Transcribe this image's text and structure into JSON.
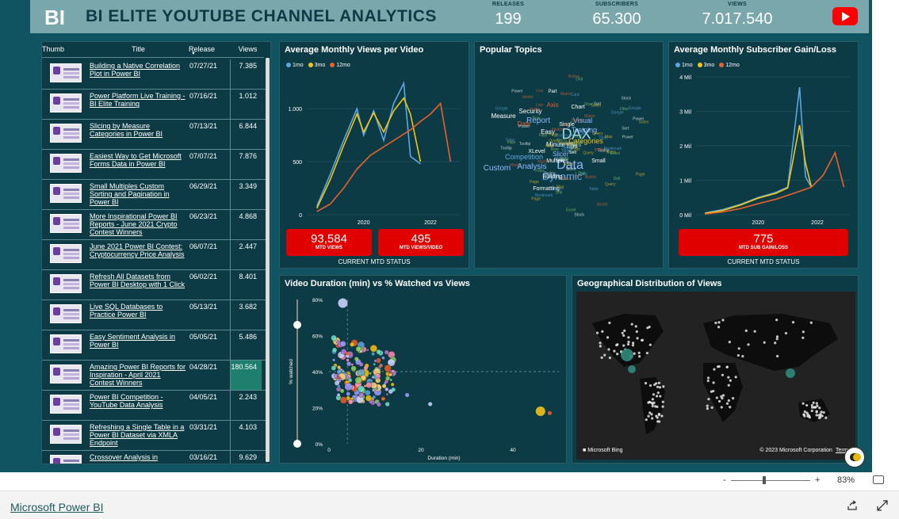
{
  "header": {
    "title": "BI ELITE YOUTUBE CHANNEL ANALYTICS",
    "logo_text": "BI",
    "kpis": [
      {
        "label": "RELEASES",
        "value": "199"
      },
      {
        "label": "SUBSCRIBERS",
        "value": "65.300"
      },
      {
        "label": "VIEWS",
        "value": "7.017.540"
      }
    ]
  },
  "table": {
    "headers": [
      "Thumb",
      "Title",
      "Release",
      "Views"
    ],
    "sort_icon": "sort-down-icon",
    "rows": [
      {
        "title": "Building a Native Correlation Plot in Power BI",
        "release": "07/27/21",
        "views": "7.385"
      },
      {
        "title": "Power Platform Live Training - BI Elite Training",
        "release": "07/16/21",
        "views": "1.012"
      },
      {
        "title": "Slicing by Measure Categories in Power BI",
        "release": "07/13/21",
        "views": "6.844"
      },
      {
        "title": "Easiest Way to Get Microsoft Forms Data in Power BI",
        "release": "07/07/21",
        "views": "7.876"
      },
      {
        "title": "Small Multiples Custom Sorting and Pagination in Power BI",
        "release": "06/29/21",
        "views": "3.349"
      },
      {
        "title": "More Inspirational Power BI Reports - June 2021 Crypto Contest Winners",
        "release": "06/23/21",
        "views": "4.868"
      },
      {
        "title": "June 2021 Power BI Contest: Cryptocurrency Price Analysis",
        "release": "06/07/21",
        "views": "2.447"
      },
      {
        "title": "Refresh All Datasets from Power BI Desktop with 1 Click",
        "release": "06/02/21",
        "views": "8.401"
      },
      {
        "title": "Live SQL Databases to Practice Power BI",
        "release": "05/13/21",
        "views": "3.682"
      },
      {
        "title": "Easy Sentiment Analysis in Power BI",
        "release": "05/05/21",
        "views": "5.486"
      },
      {
        "title": "Amazing Power BI Reports for Inspiration - April 2021 Contest Winners",
        "release": "04/28/21",
        "views": "180.564"
      },
      {
        "title": "Power BI Competition - YouTube Data Analysis",
        "release": "04/05/21",
        "views": "2.243"
      },
      {
        "title": "Refreshing a Single Table in a Power BI Dataset via XMLA Endpoint",
        "release": "03/31/21",
        "views": "4.103"
      },
      {
        "title": "Crossover Analysis in",
        "release": "03/16/21",
        "views": "9.629"
      }
    ]
  },
  "avg_views": {
    "title": "Average Monthly Views per Video",
    "legend": [
      "1mo",
      "3mo",
      "12mo"
    ],
    "kpis": [
      {
        "value": "93,584",
        "label": "MTD VIEWS"
      },
      {
        "value": "495",
        "label": "MTD VIEWS/VIDEO"
      }
    ],
    "status": "CURRENT MTD STATUS"
  },
  "topics": {
    "title": "Popular Topics"
  },
  "subs": {
    "title": "Average Monthly Subscriber Gain/Loss",
    "legend": [
      "1mo",
      "3mo",
      "12mo"
    ],
    "kpis": [
      {
        "value": "775",
        "label": "MTD SUB GAIN/LOSS"
      }
    ],
    "status": "CURRENT MTD STATUS"
  },
  "duration": {
    "title": "Video Duration (min) vs % Watched vs Views"
  },
  "geo": {
    "title": "Geographical Distribution of Views",
    "bing": "Microsoft Bing",
    "copyright": "© 2023 Microsoft Corporation",
    "terms": "Terms"
  },
  "zoom": {
    "minus": "-",
    "plus": "+",
    "level": "83%"
  },
  "footer": {
    "link": "Microsoft Power BI"
  },
  "colors": {
    "accent": "#115461",
    "kpi_red": "#e00000",
    "s1mo": "#5ba8e0",
    "s3mo": "#f2c417",
    "s12mo": "#e8612c"
  },
  "chart_data": [
    {
      "type": "line",
      "title": "Average Monthly Views per Video",
      "ylim": [
        0,
        1300
      ],
      "x_ticks": [
        "2020",
        "2022"
      ],
      "y_ticks": [
        "0",
        "500",
        "1.000"
      ],
      "series": [
        {
          "name": "1mo",
          "x": [
            2018.6,
            2019.0,
            2019.4,
            2019.8,
            2020.0,
            2020.3,
            2020.6,
            2020.9,
            2021.2,
            2021.4,
            2021.7
          ],
          "values": [
            80,
            380,
            700,
            1000,
            750,
            980,
            700,
            1050,
            1240,
            550,
            480
          ]
        },
        {
          "name": "3mo",
          "x": [
            2018.6,
            2019.0,
            2019.4,
            2019.8,
            2020.0,
            2020.3,
            2020.6,
            2020.9,
            2021.2,
            2021.4,
            2021.7
          ],
          "values": [
            60,
            330,
            650,
            950,
            780,
            960,
            780,
            980,
            1100,
            950,
            500
          ]
        },
        {
          "name": "12mo",
          "x": [
            2018.6,
            2019.0,
            2019.4,
            2019.8,
            2020.2,
            2020.6,
            2021.0,
            2021.4,
            2021.7,
            2022.0,
            2022.3,
            2022.6
          ],
          "values": [
            30,
            100,
            250,
            430,
            560,
            640,
            720,
            800,
            880,
            950,
            1050,
            500
          ]
        }
      ]
    },
    {
      "type": "line",
      "title": "Average Monthly Subscriber Gain/Loss",
      "ylim": [
        0,
        4000000
      ],
      "x_ticks": [
        "2020",
        "2022"
      ],
      "y_ticks": [
        "0 Mil",
        "1 Mil",
        "2 Mil",
        "3 Mil",
        "4 Mil"
      ],
      "series": [
        {
          "name": "1mo",
          "x": [
            2018.2,
            2018.8,
            2019.4,
            2020.0,
            2020.6,
            2021.0,
            2021.4,
            2021.6,
            2021.8
          ],
          "values": [
            50000,
            150000,
            300000,
            500000,
            650000,
            800000,
            3700000,
            1100000,
            800000
          ]
        },
        {
          "name": "3mo",
          "x": [
            2018.2,
            2018.8,
            2019.4,
            2020.0,
            2020.6,
            2021.0,
            2021.4,
            2021.6,
            2021.8
          ],
          "values": [
            40000,
            120000,
            280000,
            480000,
            620000,
            780000,
            2600000,
            1500000,
            800000
          ]
        },
        {
          "name": "12mo",
          "x": [
            2018.2,
            2018.8,
            2019.4,
            2020.0,
            2020.6,
            2021.2,
            2021.8,
            2022.2,
            2022.6,
            2022.9
          ],
          "values": [
            20000,
            80000,
            180000,
            320000,
            450000,
            620000,
            800000,
            1150000,
            1800000,
            800000
          ]
        }
      ]
    },
    {
      "type": "scatter",
      "title": "Video Duration (min) vs % Watched vs Views",
      "xlabel": "Duration (min)",
      "ylabel": "% watched",
      "xlim": [
        0,
        50
      ],
      "ylim": [
        0,
        80
      ],
      "x_ticks": [
        "0",
        "20",
        "40"
      ],
      "y_ticks": [
        "0%",
        "20%",
        "40%",
        "60%",
        "80%"
      ],
      "points": [
        {
          "x": 3,
          "y": 78
        },
        {
          "x": 5,
          "y": 55
        },
        {
          "x": 4,
          "y": 50
        },
        {
          "x": 6,
          "y": 47
        },
        {
          "x": 7,
          "y": 44
        },
        {
          "x": 8,
          "y": 42
        },
        {
          "x": 10,
          "y": 37
        },
        {
          "x": 12,
          "y": 32
        },
        {
          "x": 14,
          "y": 30
        },
        {
          "x": 17,
          "y": 27
        },
        {
          "x": 22,
          "y": 22
        },
        {
          "x": 46,
          "y": 18
        },
        {
          "x": 48,
          "y": 17
        }
      ]
    }
  ]
}
